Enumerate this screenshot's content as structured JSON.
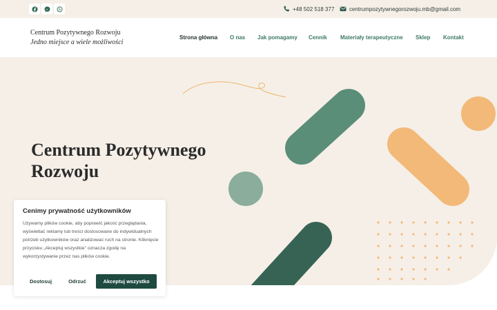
{
  "topbar": {
    "social": [
      {
        "name": "facebook-icon"
      },
      {
        "name": "messenger-icon"
      },
      {
        "name": "whatsapp-icon"
      }
    ],
    "phone": "+48 502 518 377",
    "email": "centrumpozytywnegorozwoju.mb@gmail.com"
  },
  "header": {
    "brand_name": "Centrum Pozytywnego Rozwoju",
    "brand_tagline": "Jedno miejsce a wiele możliwości",
    "nav": [
      {
        "label": "Strona główna",
        "active": true
      },
      {
        "label": "O nas"
      },
      {
        "label": "Jak pomagamy"
      },
      {
        "label": "Cennik"
      },
      {
        "label": "Materiały terapeutyczne"
      },
      {
        "label": "Sklep"
      },
      {
        "label": "Kontakt"
      }
    ]
  },
  "hero": {
    "title": "Centrum Pozytywnego Rozwoju"
  },
  "cookie": {
    "title": "Cenimy prywatność użytkowników",
    "text": "Używamy plików cookie, aby poprawić jakość przeglądania, wyświetlać reklamy lub treści dostosowane do indywidualnych potrzeb użytkowników oraz analizować ruch na stronie. Kliknięcie przycisku „Akceptuj wszystkie\" oznacza zgodę na wykorzystywanie przez nas plików cookie.",
    "buttons": {
      "customize": "Dostosuj",
      "reject": "Odrzuć",
      "accept": "Akceptuj wszystko"
    }
  },
  "colors": {
    "accent_dark_green": "#1e4a40",
    "green": "#5a8e78",
    "orange": "#f2b978",
    "background": "#f5efe7"
  }
}
